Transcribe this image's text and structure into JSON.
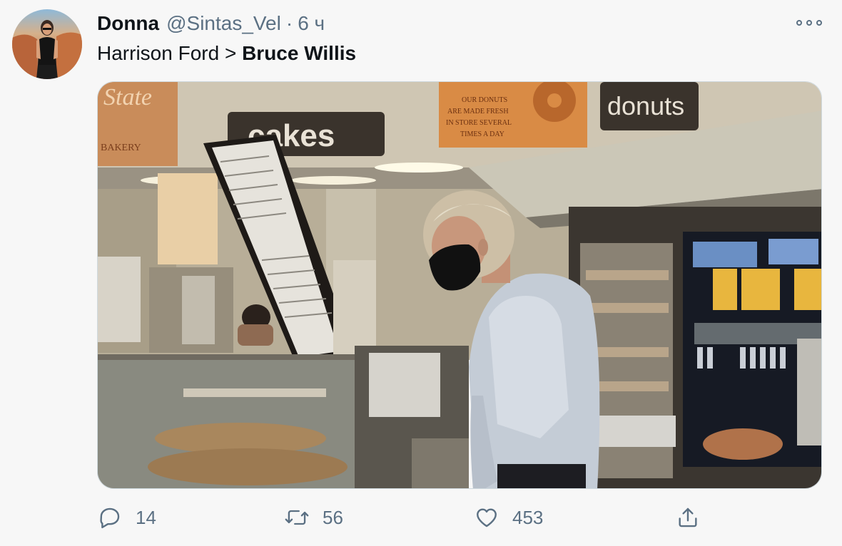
{
  "tweet": {
    "display_name": "Donna",
    "handle": "@Sintas_Vel",
    "separator": "·",
    "time": "6 ч",
    "text_plain": "Harrison Ford > ",
    "text_bold": "Bruce Willis"
  },
  "media": {
    "signs": {
      "cakes": "cakes",
      "donuts": "donuts",
      "state": "State",
      "bakery": "BAKERY",
      "donut_note": [
        "OUR DONUTS",
        "ARE MADE FRESH",
        "IN STORE SEVERAL",
        "TIMES A DAY"
      ]
    }
  },
  "actions": {
    "reply_count": "14",
    "retweet_count": "56",
    "like_count": "453"
  },
  "icons": {
    "more": "more-icon",
    "reply": "reply-icon",
    "retweet": "retweet-icon",
    "like": "heart-icon",
    "share": "share-icon"
  },
  "colors": {
    "background": "#f7f7f7",
    "secondary_text": "#5b7083",
    "primary_text": "#0f1419"
  }
}
